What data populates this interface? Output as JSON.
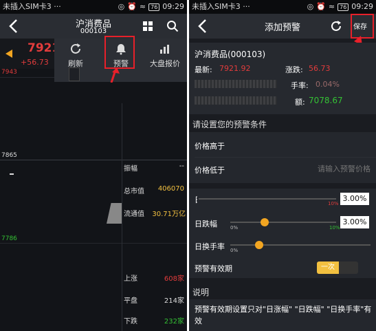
{
  "status": {
    "carrier": "未插入SIM卡3 ···",
    "battery": "76",
    "time": "09:29"
  },
  "left": {
    "title": "沪消费品",
    "code": "000103",
    "price_main": "7921",
    "change": "+56.73",
    "chart_tick_top": "7943",
    "chart_tick_mid": "7865",
    "chart_tick_low": "7786",
    "popup": {
      "refresh_label": "刷新",
      "alert_label": "预警",
      "market_label": "大盘报价"
    },
    "stats": {
      "amplitude_label": "振幅",
      "amplitude_value": "--",
      "total_mv_label": "总市值",
      "total_mv_value": "406070",
      "float_mv_label": "流通值",
      "float_mv_value": "30.71万亿",
      "up_label": "上涨",
      "up_value": "608家",
      "flat_label": "平盘",
      "flat_value": "214家",
      "down_label": "下跌",
      "down_value": "232家"
    }
  },
  "right": {
    "title": "添加预警",
    "save_label": "保存",
    "stock_name": "沪消费品(000103)",
    "latest_label": "最新:",
    "latest_value": "7921.92",
    "change_label": "涨跌:",
    "change_value": "56.73",
    "turnover_label": "手率:",
    "turnover_value": "0.04%",
    "amount_label": "额:",
    "amount_value": "7078.67",
    "section_conditions": "请设置您的预警条件",
    "price_above_label": "价格高于",
    "price_below_label": "价格低于",
    "price_below_placeholder": "请输入预警价格",
    "rise_value": "3.00%",
    "rise_scale": "10%",
    "fall_label": "日跌幅",
    "fall_value": "3.00%",
    "fall_scale_min": "0%",
    "fall_scale_max": "10%",
    "turnover_slider_label": "日换手率",
    "turnover_scale_min": "0%",
    "validity_label": "预警有效期",
    "validity_toggle": "一次",
    "section_note": "说明",
    "note_text": "预警有效期设置只对\"日涨幅\" \"日跌幅\" \"日换手率\"有效"
  }
}
